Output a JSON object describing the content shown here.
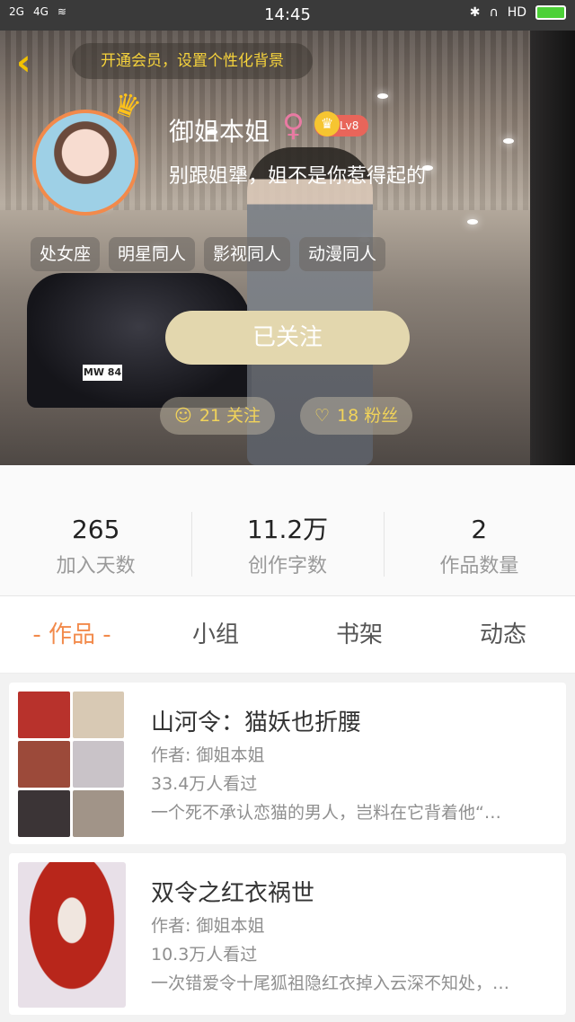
{
  "status_bar": {
    "signal1": "2G",
    "signal2": "4G",
    "time": "14:45",
    "hd": "HD"
  },
  "header": {
    "vip_banner": "开通会员，设置个性化背景"
  },
  "profile": {
    "nickname": "御姐本姐",
    "gender_symbol": "♀",
    "level": "Lv8",
    "bio": "别跟姐犟，姐不是你惹得起的",
    "tags": [
      "处女座",
      "明星同人",
      "影视同人",
      "动漫同人"
    ],
    "follow_button": "已关注",
    "following": "21 关注",
    "fans": "18 粉丝"
  },
  "stats": [
    {
      "value": "265",
      "label": "加入天数"
    },
    {
      "value": "11.2万",
      "label": "创作字数"
    },
    {
      "value": "2",
      "label": "作品数量"
    }
  ],
  "tabs": [
    "- 作品 -",
    "小组",
    "书架",
    "动态"
  ],
  "works": [
    {
      "title": "山河令：猫妖也折腰",
      "author": "作者: 御姐本姐",
      "views": "33.4万人看过",
      "desc": "一个死不承认恋猫的男人，岂料在它背着他“…"
    },
    {
      "title": "双令之红衣祸世",
      "author": "作者: 御姐本姐",
      "views": "10.3万人看过",
      "desc": "一次错爱令十尾狐祖隐红衣掉入云深不知处，…"
    }
  ],
  "colors": {
    "accent": "#f28a4b",
    "vip_text": "#f6d33c",
    "follow_button_bg": "#e3d7ae"
  }
}
